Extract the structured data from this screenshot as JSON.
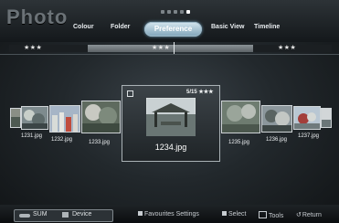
{
  "header": {
    "title": "Photo",
    "tabs": [
      "Colour",
      "Folder",
      "Preference",
      "Basic View",
      "Timeline"
    ],
    "selected_tab": "Preference",
    "page_dots_total": 5,
    "page_dots_active": 5
  },
  "rating_bar": {
    "left": "★★★",
    "center": "★★★",
    "right": "★★★"
  },
  "thumbnails": {
    "left": [
      {
        "label": "1231.jpg"
      },
      {
        "label": "1232.jpg"
      },
      {
        "label": "1233.jpg"
      }
    ],
    "selected": {
      "label": "1234.jpg",
      "counter": "5/15",
      "stars": "★★★"
    },
    "right": [
      {
        "label": "1235.jpg"
      },
      {
        "label": "1236.jpg"
      },
      {
        "label": "1237.jpg"
      }
    ]
  },
  "footer": {
    "sum_label": "SUM",
    "device_label": "Device",
    "favourites_label": "Favourites Settings",
    "select_label": "Select",
    "tools_label": "Tools",
    "return_label": "Return"
  },
  "colors": {
    "accent_tab": "#9ebfd1",
    "background": "#22282c"
  }
}
